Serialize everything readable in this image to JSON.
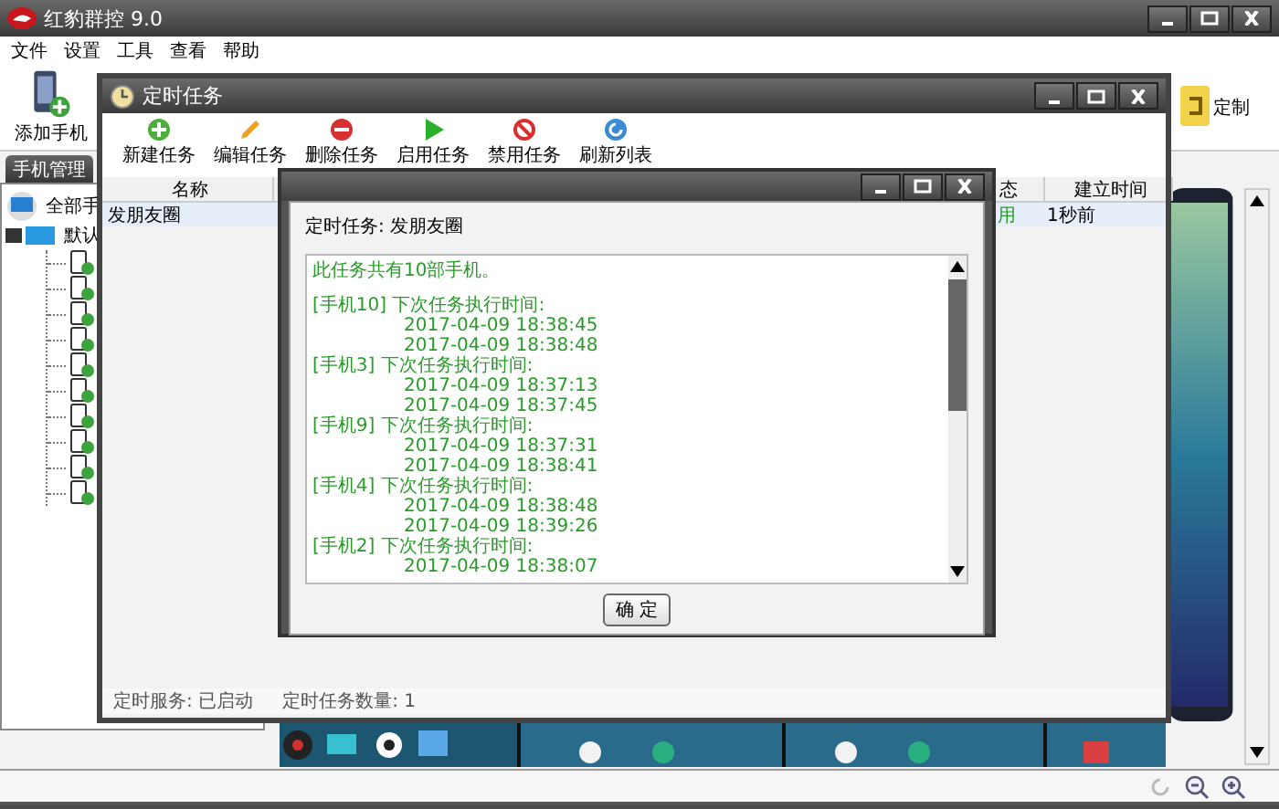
{
  "app": {
    "title": "红豹群控 9.0",
    "menu": [
      "文件",
      "设置",
      "工具",
      "查看",
      "帮助"
    ],
    "toolbar": [
      {
        "kind": "phone",
        "label": "添加手机"
      },
      {
        "kind": "custom",
        "label": "定制"
      }
    ],
    "tab": {
      "label": "手机管理",
      "selected": true
    },
    "tree": {
      "root": "全部手",
      "group": "默认",
      "children": [
        {
          "online": true
        },
        {
          "online": true
        },
        {
          "online": true
        },
        {
          "online": true
        },
        {
          "online": true
        },
        {
          "online": true
        },
        {
          "online": true
        },
        {
          "online": true
        },
        {
          "online": true
        },
        {
          "online": true
        }
      ]
    }
  },
  "task_window": {
    "title": "定时任务",
    "toolbar": [
      {
        "kind": "add",
        "label": "新建任务"
      },
      {
        "kind": "edit",
        "label": "编辑任务"
      },
      {
        "kind": "delete",
        "label": "删除任务"
      },
      {
        "kind": "start",
        "label": "启用任务"
      },
      {
        "kind": "stop",
        "label": "禁用任务"
      },
      {
        "kind": "refresh",
        "label": "刷新列表"
      }
    ],
    "columns": [
      "名称",
      "态",
      "建立时间"
    ],
    "rows": [
      {
        "cells": [
          "发朋友圈",
          "用",
          "1秒前"
        ],
        "selected": true
      }
    ],
    "status_bar": [
      "定时服务: 已启动",
      "定时任务数量: 1"
    ]
  },
  "dialog": {
    "heading": "定时任务: 发朋友圈",
    "summary": "此任务共有10部手机。",
    "entries": [
      {
        "phone": "[手机10] 下次任务执行时间:",
        "times": [
          "2017-04-09 18:38:45",
          "2017-04-09 18:38:48"
        ]
      },
      {
        "phone": "[手机3] 下次任务执行时间:",
        "times": [
          "2017-04-09 18:37:13",
          "2017-04-09 18:37:45"
        ]
      },
      {
        "phone": "[手机9] 下次任务执行时间:",
        "times": [
          "2017-04-09 18:37:31",
          "2017-04-09 18:38:41"
        ]
      },
      {
        "phone": "[手机4] 下次任务执行时间:",
        "times": [
          "2017-04-09 18:38:48",
          "2017-04-09 18:39:26"
        ]
      },
      {
        "phone": "[手机2] 下次任务执行时间:",
        "times": [
          "2017-04-09 18:38:07"
        ]
      }
    ],
    "button": "确 定"
  }
}
